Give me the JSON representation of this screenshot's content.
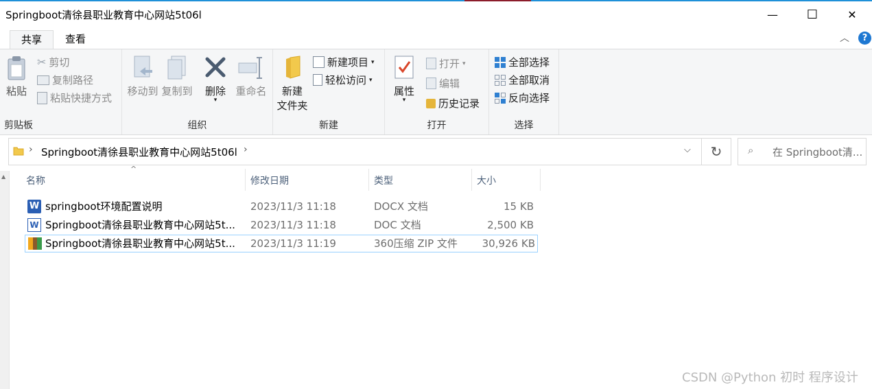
{
  "window": {
    "title": "Springboot清徐县职业教育中心网站5t06l",
    "minimize_glyph": "—",
    "maximize_glyph": "☐",
    "close_glyph": "✕"
  },
  "tabs": {
    "share": "共享",
    "view": "查看"
  },
  "ribbon": {
    "clipboard": {
      "paste": "粘贴",
      "cut": "剪切",
      "copy_path": "复制路径",
      "paste_shortcut": "粘贴快捷方式",
      "label": "剪贴板"
    },
    "organize": {
      "move_to": "移动到",
      "copy_to": "复制到",
      "delete": "删除",
      "rename": "重命名",
      "label": "组织"
    },
    "new": {
      "new_folder_line1": "新建",
      "new_folder_line2": "文件夹",
      "new_item": "新建项目",
      "easy_access": "轻松访问",
      "label": "新建"
    },
    "open": {
      "properties": "属性",
      "open": "打开",
      "edit": "编辑",
      "history": "历史记录",
      "label": "打开"
    },
    "select": {
      "select_all": "全部选择",
      "select_none": "全部取消",
      "invert": "反向选择",
      "label": "选择"
    },
    "help_glyph": "?",
    "collapse_glyph": "︿"
  },
  "address": {
    "path": "Springboot清徐县职业教育中心网站5t06l",
    "search_placeholder": "在 Springboot清..."
  },
  "columns": {
    "name": "名称",
    "modified": "修改日期",
    "type": "类型",
    "size": "大小",
    "sort_glyph": "^"
  },
  "files": [
    {
      "name": "springboot环境配置说明",
      "modified": "2023/11/3 11:18",
      "type": "DOCX 文档",
      "size": "15 KB"
    },
    {
      "name": "Springboot清徐县职业教育中心网站5t...",
      "modified": "2023/11/3 11:18",
      "type": "DOC 文档",
      "size": "2,500 KB"
    },
    {
      "name": "Springboot清徐县职业教育中心网站5t...",
      "modified": "2023/11/3 11:19",
      "type": "360压缩 ZIP 文件",
      "size": "30,926 KB"
    }
  ],
  "watermark": "CSDN @Python 初时 程序设计",
  "colors": {
    "accent": "#1e90d8",
    "selection_border": "#99d1ff",
    "folder": "#f2c94c",
    "word_blue": "#2b5fb4"
  }
}
